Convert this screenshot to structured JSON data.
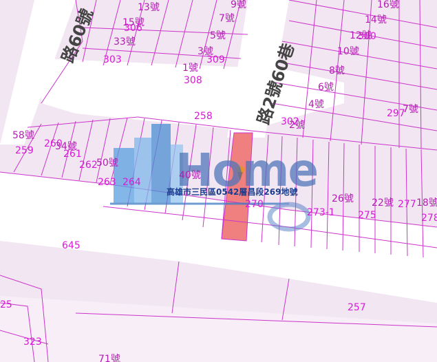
{
  "map": {
    "colors": {
      "background": "#f1e6f1",
      "road": "#ffffff",
      "parcel_line": "#cc33cc",
      "highlight": "#f08080",
      "label": "#b11fb1"
    },
    "street_labels": {
      "street_a": "路60號",
      "street_b": "路2號60巷"
    },
    "parcel_numbers": {
      "p258": "258",
      "p259": "259",
      "p260": "260",
      "p261": "261",
      "p262": "262",
      "p263": "263",
      "p264": "264",
      "p270": "270",
      "p2731": "273-1",
      "p275": "275",
      "p257": "257",
      "p645": "645",
      "p308": "308",
      "p309": "309",
      "p302": "302",
      "p297": "297",
      "p323": "323",
      "p325": "25",
      "p2771": "277",
      "p278": "278",
      "p303": "303",
      "p306": "306",
      "p300": "300"
    },
    "house_numbers": {
      "h58": "58號",
      "h34": "34號",
      "h50": "50號",
      "h40": "40號",
      "h26": "26號",
      "h22": "22號",
      "h18": "18號",
      "h1": "1號",
      "h3": "3號",
      "h5": "5號",
      "h7": "7號",
      "h9": "9號",
      "h2": "2號",
      "h4": "4號",
      "h6": "6號",
      "h8": "8號",
      "h10": "10號",
      "h12": "12號",
      "h14": "14號",
      "h16": "16號",
      "h7b": "7號",
      "h71": "71號",
      "h15": "15號",
      "h13": "13號",
      "h33": "33號"
    },
    "highlighted_parcel": "269",
    "caption": "高雄市三民區0542層昌段269地號",
    "watermark": "Home"
  }
}
